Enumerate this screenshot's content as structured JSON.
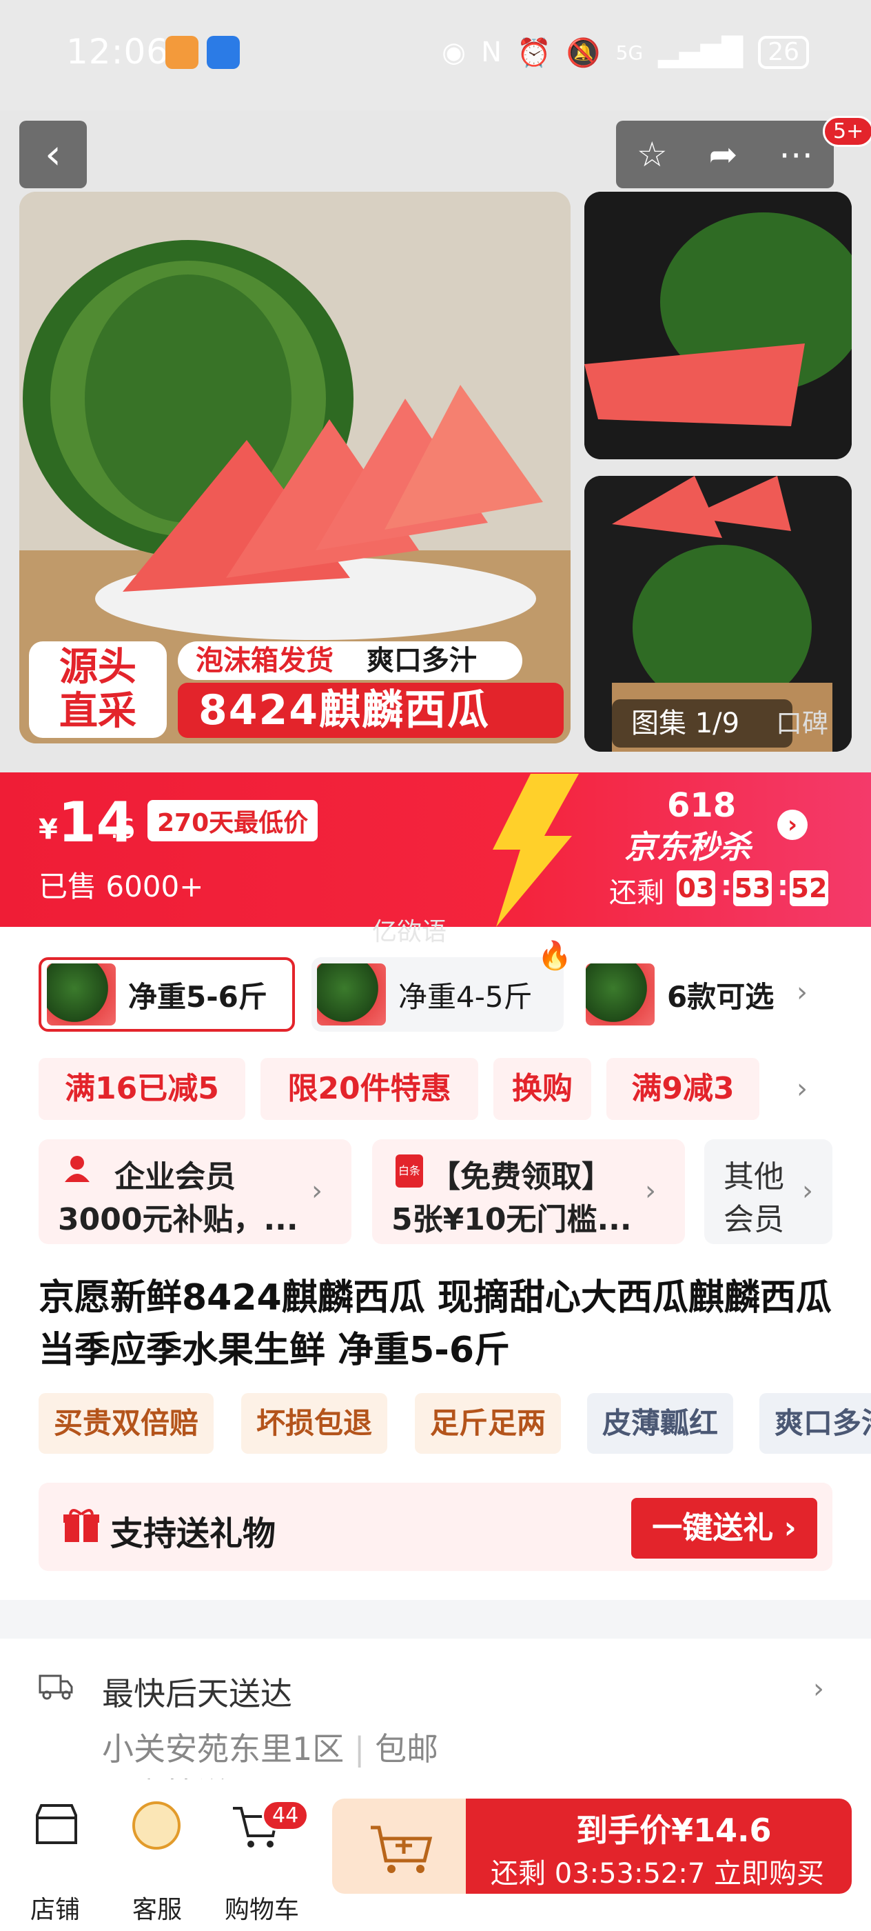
{
  "status_bar": {
    "time": "12:06",
    "network": "5G",
    "battery": "26"
  },
  "top_actions": {
    "more_badge": "5+"
  },
  "hero": {
    "tag_source_line1": "源头",
    "tag_source_line2": "直采",
    "tag_shipping": "泡沫箱发货",
    "tag_taste": "爽口多汁",
    "tag_product": "8424麒麟西瓜",
    "gallery_label": "图集 1/9",
    "reviews_label": "口碑"
  },
  "price_bar": {
    "currency": "¥",
    "price_int": "14",
    "price_dec": ".6",
    "lowest_badge": "270天最低价",
    "sold": "已售 6000+",
    "promo_618": "618",
    "promo_name": "京东秒杀",
    "remain_label": "还剩",
    "countdown": [
      "03",
      "53",
      "52"
    ],
    "watermark": "亿欲语"
  },
  "specs": [
    {
      "label": "净重5-6斤",
      "selected": true
    },
    {
      "label": "净重4-5斤",
      "selected": false
    },
    {
      "label": "6款可选",
      "selected": false
    }
  ],
  "promos": [
    "满16已减5",
    "限20件特惠",
    "换购",
    "满9减3"
  ],
  "members": [
    {
      "line1": "企业会员",
      "line2": "3000元补贴，..."
    },
    {
      "line1": "【免费领取】",
      "line2": "5张¥10无门槛..."
    },
    {
      "line1": "其他",
      "line2": "会员"
    }
  ],
  "member_icon_text": "白条",
  "product_title": "京愿新鲜8424麒麟西瓜 现摘甜心大西瓜麒麟西瓜当季应季水果生鲜 净重5-6斤",
  "service_chips": [
    "买贵双倍赔",
    "坏损包退",
    "足斤足两",
    "皮薄瓤红",
    "爽口多汁"
  ],
  "gift": {
    "label": "支持送礼物",
    "button": "一键送礼"
  },
  "delivery": {
    "eta": "最快后天送达",
    "address": "小关安苑东里1区",
    "shipping": "包邮",
    "partial": "示文技送"
  },
  "bottom_bar": {
    "store": "店铺",
    "service": "客服",
    "cart": "购物车",
    "cart_count": "44",
    "buy_label": "到手价¥14.6",
    "buy_sub": "还剩 03:53:52:7  立即购买"
  },
  "colors": {
    "accent_red": "#e3242b",
    "promo_bg": "#fff1f1",
    "chip_orange": "#b4541b",
    "chip_gray": "#4b5874"
  }
}
